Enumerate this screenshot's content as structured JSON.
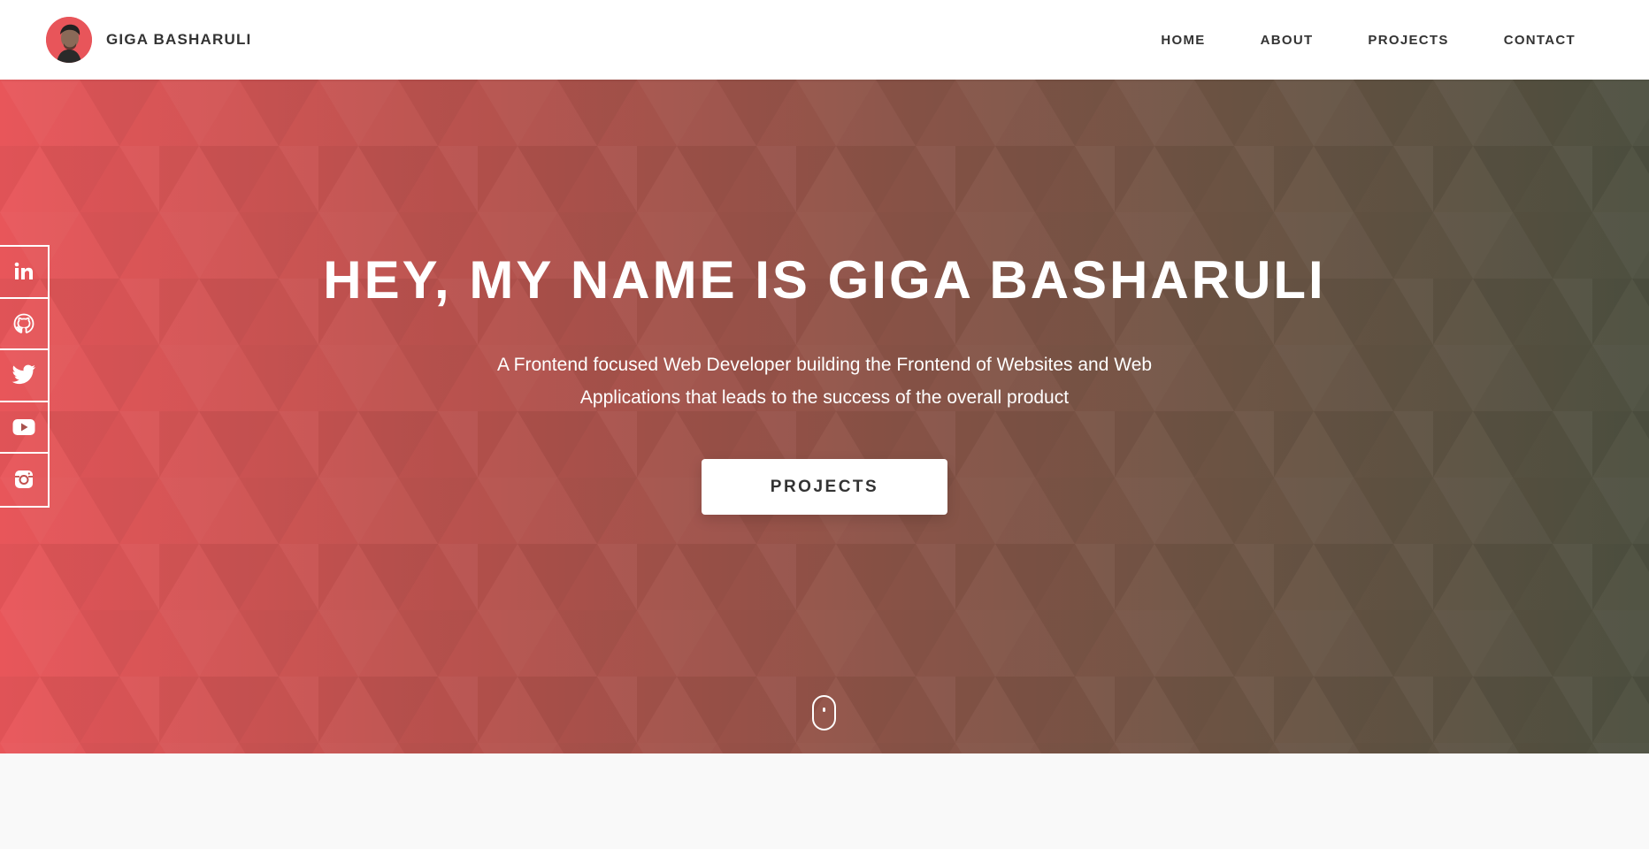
{
  "header": {
    "brand_name": "GIGA BASHARULI",
    "avatar_icon": "profile-photo",
    "nav": [
      {
        "label": "HOME"
      },
      {
        "label": "ABOUT"
      },
      {
        "label": "PROJECTS"
      },
      {
        "label": "CONTACT"
      }
    ]
  },
  "hero": {
    "title": "HEY, MY NAME IS GIGA BASHARULI",
    "subtitle_line1": "A Frontend focused Web Developer building the Frontend of Websites and Web",
    "subtitle_line2": "Applications that leads to the success of the overall product",
    "cta_label": "PROJECTS",
    "scroll_icon": "mouse-scroll-icon"
  },
  "social": [
    {
      "icon": "linkedin-icon"
    },
    {
      "icon": "github-icon"
    },
    {
      "icon": "twitter-icon"
    },
    {
      "icon": "youtube-icon"
    },
    {
      "icon": "instagram-icon"
    }
  ],
  "colors": {
    "hero_gradient_start": "#e8565a",
    "hero_gradient_end": "#4d5040",
    "header_bg": "#ffffff",
    "text_dark": "#333333",
    "page_bg": "#f9f9f9"
  }
}
